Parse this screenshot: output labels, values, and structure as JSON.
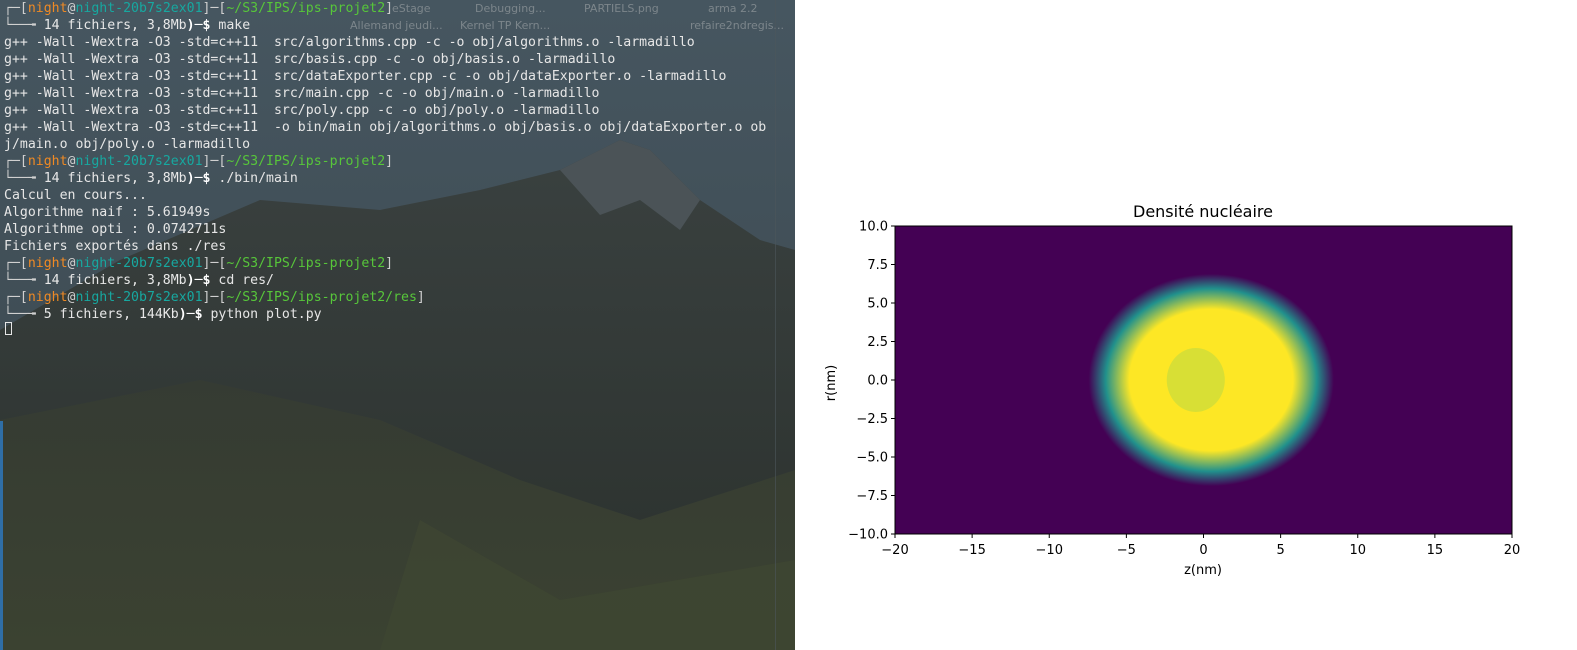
{
  "desktop_labels": [
    "eStage",
    "PARTIELS.png",
    "arma 2.2",
    "Debugging...",
    "Allemand jeudi...",
    "Kernel TP Kern...",
    "refaire2ndregis..."
  ],
  "terminal": {
    "lines": [
      {
        "type": "prompt",
        "user": "night",
        "host": "night-20b7s2ex01",
        "path": "~/S3/IPS/ips-projet2",
        "info": "14 fichiers, 3,8Mb",
        "cmd": "make"
      },
      {
        "type": "out",
        "text": "g++ -Wall -Wextra -O3 -std=c++11  src/algorithms.cpp -c -o obj/algorithms.o -larmadillo"
      },
      {
        "type": "out",
        "text": "g++ -Wall -Wextra -O3 -std=c++11  src/basis.cpp -c -o obj/basis.o -larmadillo"
      },
      {
        "type": "out",
        "text": "g++ -Wall -Wextra -O3 -std=c++11  src/dataExporter.cpp -c -o obj/dataExporter.o -larmadillo"
      },
      {
        "type": "out",
        "text": "g++ -Wall -Wextra -O3 -std=c++11  src/main.cpp -c -o obj/main.o -larmadillo"
      },
      {
        "type": "out",
        "text": "g++ -Wall -Wextra -O3 -std=c++11  src/poly.cpp -c -o obj/poly.o -larmadillo"
      },
      {
        "type": "out",
        "text": "g++ -Wall -Wextra -O3 -std=c++11  -o bin/main obj/algorithms.o obj/basis.o obj/dataExporter.o ob"
      },
      {
        "type": "out",
        "text": "j/main.o obj/poly.o -larmadillo"
      },
      {
        "type": "prompt",
        "user": "night",
        "host": "night-20b7s2ex01",
        "path": "~/S3/IPS/ips-projet2",
        "info": "14 fichiers, 3,8Mb",
        "cmd": "./bin/main"
      },
      {
        "type": "out",
        "text": "Calcul en cours..."
      },
      {
        "type": "out",
        "text": "Algorithme naif : 5.61949s"
      },
      {
        "type": "out",
        "text": "Algorithme opti : 0.0742711s"
      },
      {
        "type": "out",
        "text": "Fichiers exportés dans ./res"
      },
      {
        "type": "prompt",
        "user": "night",
        "host": "night-20b7s2ex01",
        "path": "~/S3/IPS/ips-projet2",
        "info": "14 fichiers, 3,8Mb",
        "cmd": "cd res/"
      },
      {
        "type": "prompt",
        "user": "night",
        "host": "night-20b7s2ex01",
        "path": "~/S3/IPS/ips-projet2/res",
        "info": "5 fichiers, 144Kb",
        "cmd": "python plot.py"
      }
    ],
    "colors": {
      "user": "#f08a24",
      "host": "#17a8a0",
      "path": "#57c63a",
      "text": "#e6e6e6"
    }
  },
  "chart_data": {
    "type": "heatmap",
    "title": "Densité nucléaire",
    "xlabel": "z(nm)",
    "ylabel": "r(nm)",
    "xlim": [
      -20,
      20
    ],
    "ylim": [
      -10,
      10
    ],
    "xticks": [
      -20,
      -15,
      -10,
      -5,
      0,
      5,
      10,
      15,
      20
    ],
    "yticks": [
      -10.0,
      -7.5,
      -5.0,
      -2.5,
      0.0,
      2.5,
      5.0,
      7.5,
      10.0
    ],
    "colormap": "viridis",
    "colors": {
      "low": "#440154",
      "mid": "#21918c",
      "high": "#fde725"
    },
    "density_blob": {
      "center_z": 0.5,
      "center_r": 0.0,
      "half_width_z": 7.5,
      "half_height_r": 6.5
    }
  }
}
